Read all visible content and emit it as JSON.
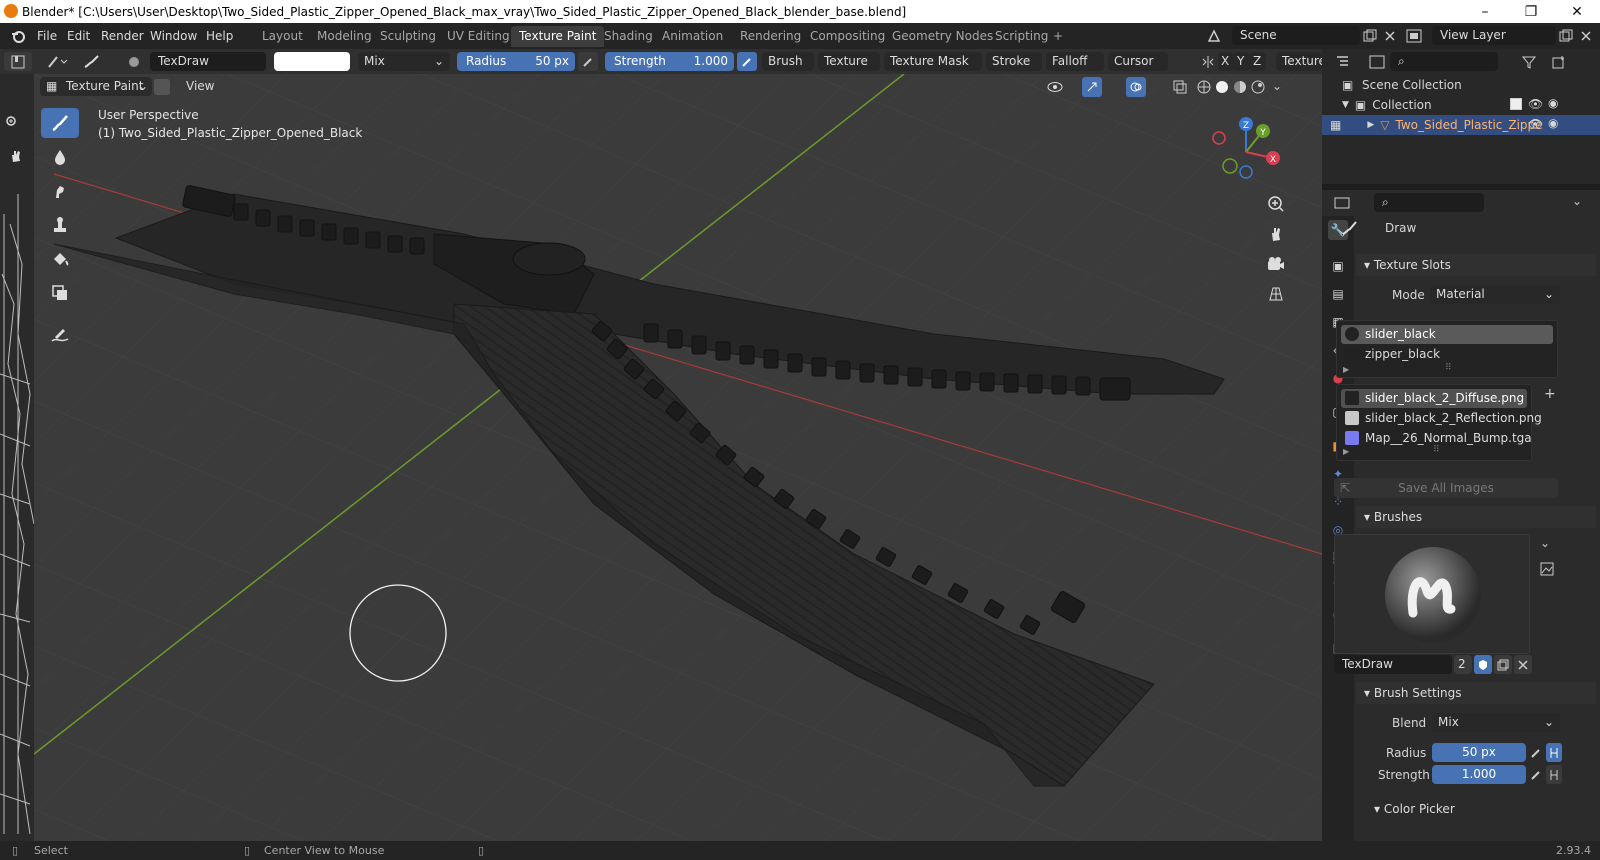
{
  "window": {
    "title": "Blender* [C:\\Users\\User\\Desktop\\Two_Sided_Plastic_Zipper_Opened_Black_max_vray\\Two_Sided_Plastic_Zipper_Opened_Black_blender_base.blend]",
    "minimize": "–",
    "maximize": "❐",
    "close": "✕"
  },
  "menu": [
    "File",
    "Edit",
    "Render",
    "Window",
    "Help"
  ],
  "workspaces": [
    "Layout",
    "Modeling",
    "Sculpting",
    "UV Editing",
    "Texture Paint",
    "Shading",
    "Animation",
    "Rendering",
    "Compositing",
    "Geometry Nodes",
    "Scripting",
    "+"
  ],
  "active_workspace": "Texture Paint",
  "scene": {
    "label": "Scene",
    "view_layer": "View Layer"
  },
  "toolheader": {
    "brush_name": "TexDraw",
    "blend": "Mix",
    "radius_label": "Radius",
    "radius_value": "50 px",
    "strength_label": "Strength",
    "strength_value": "1.000",
    "menus": [
      "Brush",
      "Texture",
      "Texture Mask",
      "Stroke",
      "Falloff",
      "Cursor"
    ],
    "axes": [
      "X",
      "Y",
      "Z"
    ],
    "texture_label": "Texture"
  },
  "viewport": {
    "mode": "Texture Paint",
    "view_menu": "View",
    "perspective": "User Perspective",
    "object": "(1) Two_Sided_Plastic_Zipper_Opened_Black",
    "gizmo": {
      "x": "X",
      "y": "Y",
      "z": "Z"
    }
  },
  "outliner": {
    "scene_collection": "Scene Collection",
    "collection": "Collection",
    "object": "Two_Sided_Plastic_Zippe"
  },
  "properties": {
    "tool_name": "Draw",
    "texture_slots": {
      "header": "Texture Slots",
      "mode_label": "Mode",
      "mode_value": "Material",
      "materials": [
        "slider_black",
        "zipper_black"
      ],
      "images": [
        {
          "name": "slider_black_2_Diffuse.png",
          "color": "#222222"
        },
        {
          "name": "slider_black_2_Reflection.png",
          "color": "#c8c8c8"
        },
        {
          "name": "Map__26_Normal_Bump.tga",
          "color": "#7a7af0"
        }
      ],
      "save_all": "Save All Images"
    },
    "brushes": {
      "header": "Brushes",
      "name": "TexDraw",
      "users": "2"
    },
    "brush_settings": {
      "header": "Brush Settings",
      "blend_label": "Blend",
      "blend_value": "Mix",
      "radius_label": "Radius",
      "radius_value": "50 px",
      "strength_label": "Strength",
      "strength_value": "1.000",
      "color_picker": "Color Picker"
    }
  },
  "statusbar": {
    "select": "Select",
    "center_view": "Center View to Mouse",
    "version": "2.93.4"
  }
}
